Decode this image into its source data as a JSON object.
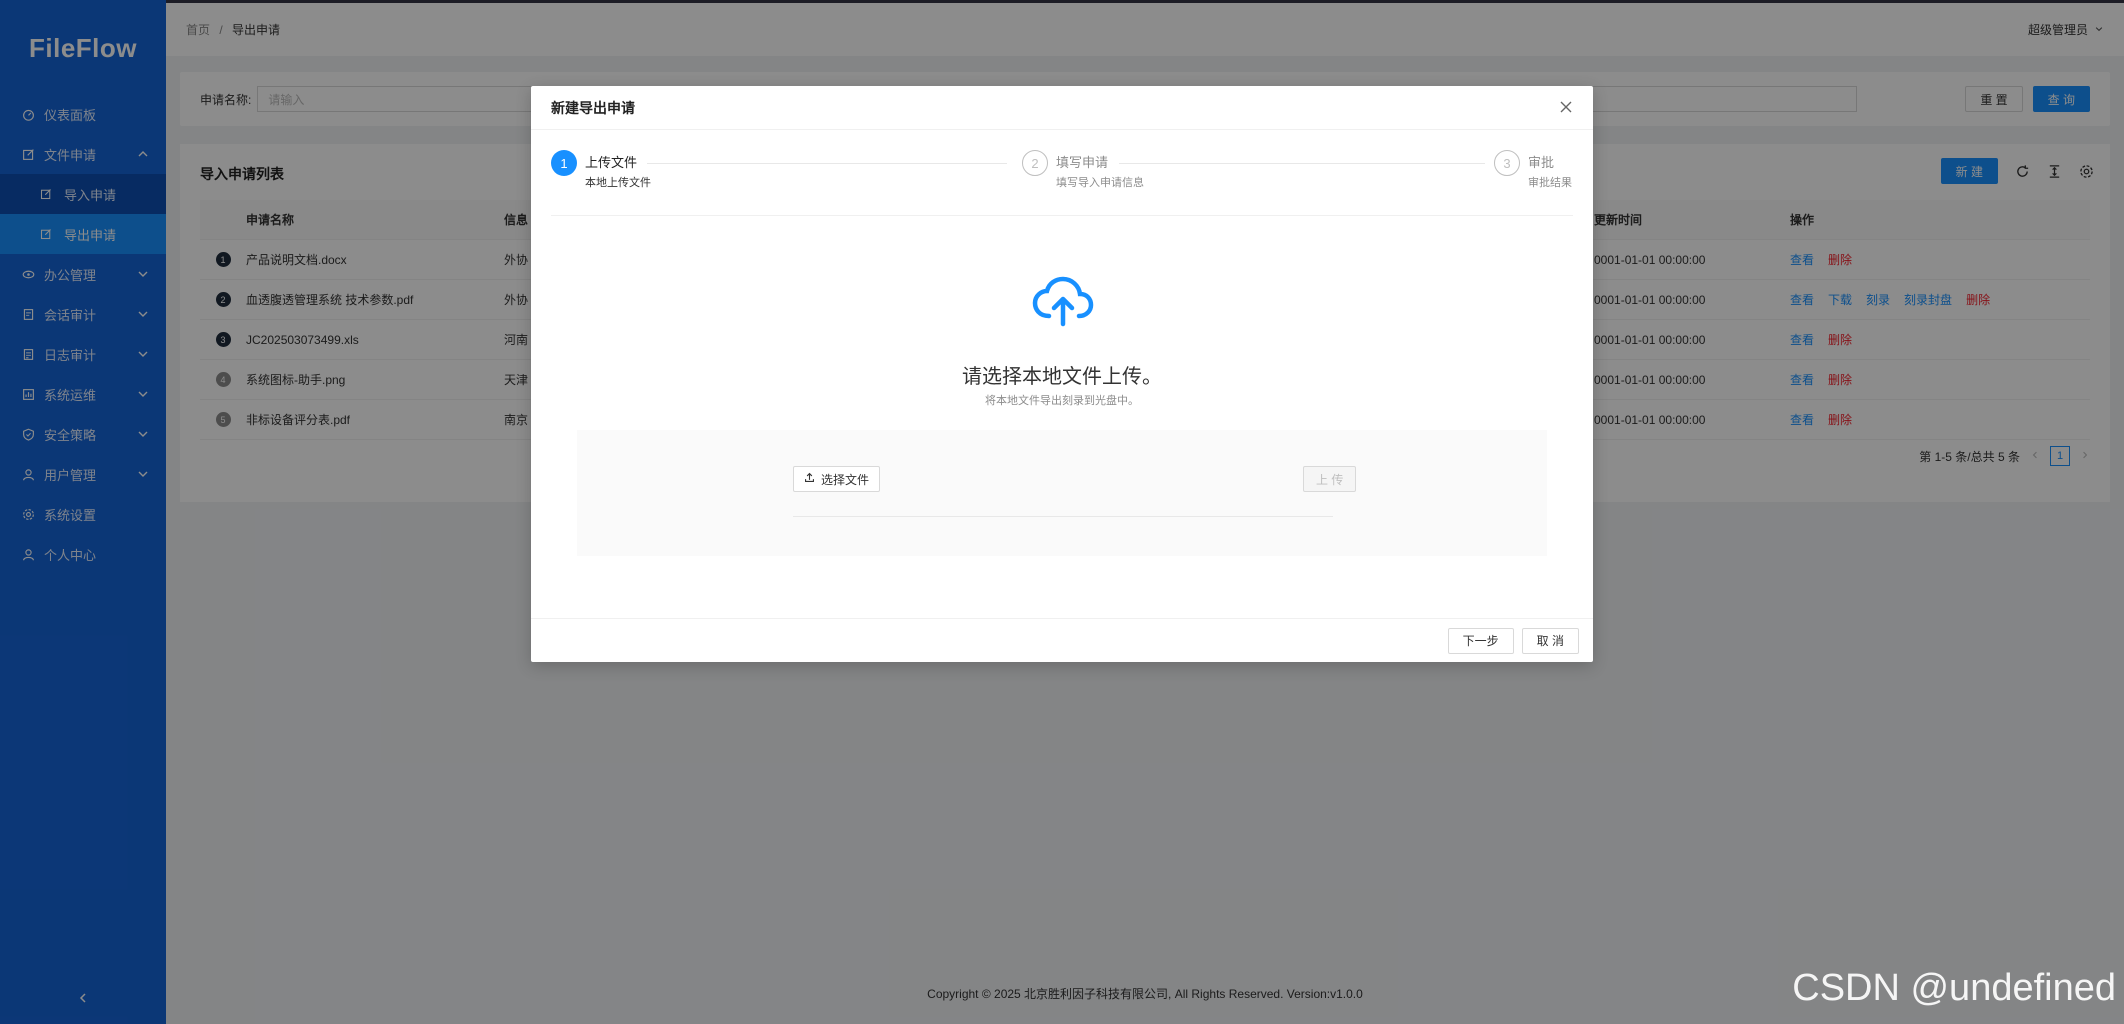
{
  "app": {
    "logo": "FileFlow"
  },
  "sidebar": {
    "items": [
      {
        "label": "仪表面板",
        "icon": "dashboard-icon"
      },
      {
        "label": "文件申请",
        "icon": "edit-icon",
        "expanded": true,
        "children": [
          {
            "label": "导入申请"
          },
          {
            "label": "导出申请",
            "active": true
          }
        ]
      },
      {
        "label": "办公管理",
        "icon": "eye-icon"
      },
      {
        "label": "会话审计",
        "icon": "audit-icon"
      },
      {
        "label": "日志审计",
        "icon": "log-icon"
      },
      {
        "label": "系统运维",
        "icon": "ops-icon"
      },
      {
        "label": "安全策略",
        "icon": "shield-icon"
      },
      {
        "label": "用户管理",
        "icon": "user-icon"
      },
      {
        "label": "系统设置",
        "icon": "gear-icon"
      },
      {
        "label": "个人中心",
        "icon": "person-icon"
      }
    ]
  },
  "header": {
    "breadcrumb": [
      "首页",
      "导出申请"
    ],
    "breadcrumb_sep": "/",
    "user": "超级管理员"
  },
  "search": {
    "label": "申请名称:",
    "placeholder": "请输入",
    "reset": "重 置",
    "query": "查 询"
  },
  "table": {
    "title": "导入申请列表",
    "new_btn": "新 建",
    "columns": {
      "name": "申请名称",
      "info": "信息",
      "time": "更新时间",
      "ops": "操作"
    },
    "rows": [
      {
        "idx": "1",
        "name": "产品说明文档.docx",
        "info": "外协",
        "time": "0001-01-01 00:00:00",
        "ops": [
          "查看",
          "删除"
        ]
      },
      {
        "idx": "2",
        "name": "血透腹透管理系统 技术参数.pdf",
        "info": "外协",
        "time": "0001-01-01 00:00:00",
        "ops": [
          "查看",
          "下载",
          "刻录",
          "刻录封盘",
          "删除"
        ]
      },
      {
        "idx": "3",
        "name": "JC202503073499.xls",
        "info": "河南",
        "time": "0001-01-01 00:00:00",
        "ops": [
          "查看",
          "删除"
        ]
      },
      {
        "idx": "4",
        "name": "系统图标-助手.png",
        "info": "天津",
        "time": "0001-01-01 00:00:00",
        "ops": [
          "查看",
          "删除"
        ]
      },
      {
        "idx": "5",
        "name": "非标设备评分表.pdf",
        "info": "南京",
        "time": "0001-01-01 00:00:00",
        "ops": [
          "查看",
          "删除"
        ]
      }
    ],
    "pagination": {
      "summary": "第 1-5 条/总共 5 条",
      "current": "1"
    }
  },
  "footer": {
    "copyright": "Copyright © 2025 北京胜利因子科技有限公司, All Rights Reserved. Version:v1.0.0"
  },
  "watermark": "CSDN @undefined",
  "modal": {
    "title": "新建导出申请",
    "steps": [
      {
        "num": "1",
        "title": "上传文件",
        "desc": "本地上传文件",
        "status": "process"
      },
      {
        "num": "2",
        "title": "填写申请",
        "desc": "填写导入申请信息",
        "status": "wait"
      },
      {
        "num": "3",
        "title": "审批",
        "desc": "审批结果",
        "status": "wait"
      }
    ],
    "upload_title": "请选择本地文件上传。",
    "upload_sub": "将本地文件导出刻录到光盘中。",
    "choose_btn": "选择文件",
    "upload_btn": "上 传",
    "next_btn": "下一步",
    "cancel_btn": "取 消"
  },
  "colors": {
    "sidebar": "#1565d8",
    "primary": "#1890ff",
    "danger": "#f5222d"
  }
}
